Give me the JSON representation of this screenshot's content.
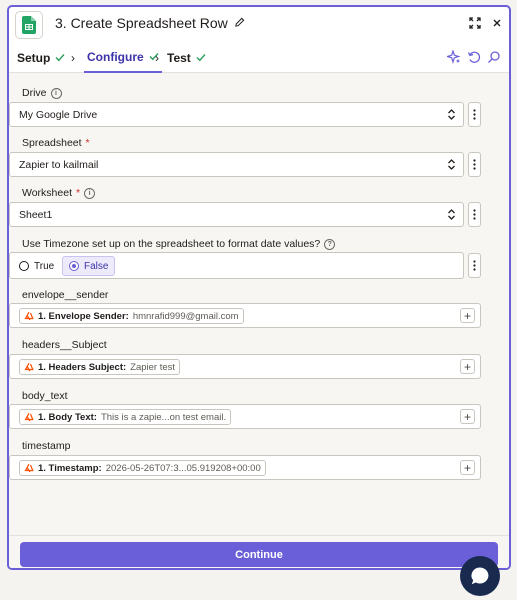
{
  "header": {
    "title": "3. Create Spreadsheet Row",
    "app_icon": "google-sheets-icon",
    "edit_icon": "pencil-icon",
    "expand_icon": "expand-icon",
    "close_icon": "close-icon"
  },
  "tabs": [
    {
      "label": "Setup",
      "status": "done"
    },
    {
      "label": "Configure",
      "status": "done",
      "active": true
    },
    {
      "label": "Test",
      "status": "done"
    }
  ],
  "tab_tools": [
    "sparkle-icon",
    "undo-icon",
    "search-icon"
  ],
  "fields": {
    "drive": {
      "label": "Drive",
      "value": "My Google Drive"
    },
    "spreadsheet": {
      "label": "Spreadsheet",
      "required": "*",
      "value": "Zapier to kailmail"
    },
    "worksheet": {
      "label": "Worksheet",
      "required": "*",
      "value": "Sheet1"
    },
    "timezone": {
      "label": "Use Timezone set up on the spreadsheet to format date values?",
      "options": [
        "True",
        "False"
      ],
      "selected": "False"
    },
    "envelope_sender": {
      "label": "envelope__sender",
      "pill_label": "1. Envelope Sender:",
      "pill_value": "hmnrafid999@gmail.com"
    },
    "headers_subject": {
      "label": "headers__Subject",
      "pill_label": "1. Headers Subject:",
      "pill_value": "Zapier test"
    },
    "body_text": {
      "label": "body_text",
      "pill_label": "1. Body Text:",
      "pill_value": "This is a zapie...on test email."
    },
    "timestamp": {
      "label": "timestamp",
      "pill_label": "1. Timestamp:",
      "pill_value": "2026-05-26T07:3...05.919208+00:00"
    }
  },
  "footer": {
    "continue_label": "Continue"
  },
  "colors": {
    "accent": "#6a5fd8",
    "success": "#2e9e5b",
    "zapier_orange": "#ff4f00"
  }
}
